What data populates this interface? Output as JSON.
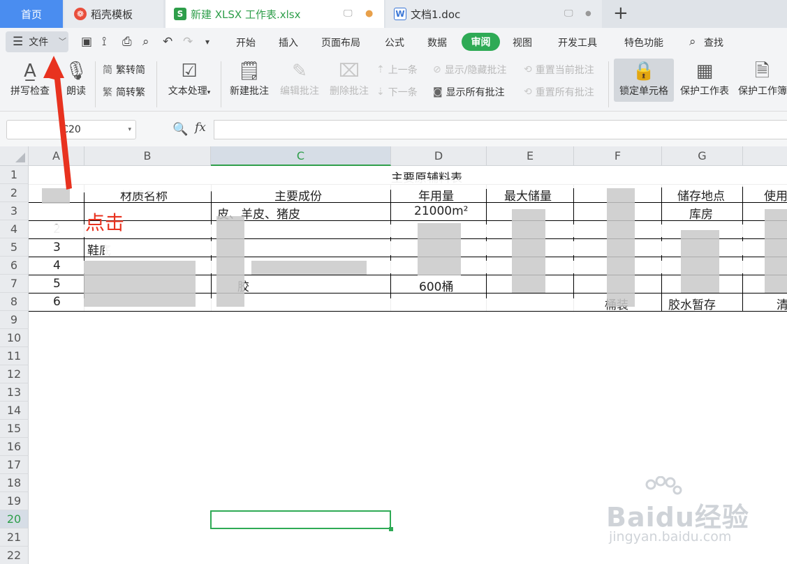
{
  "tabs": {
    "home": "首页",
    "template": "稻壳模板",
    "xlsx": "新建 XLSX 工作表.xlsx",
    "word": "文档1.doc",
    "add": "+"
  },
  "menu": {
    "file": "文件",
    "items": [
      "开始",
      "插入",
      "页面布局",
      "公式",
      "数据",
      "审阅",
      "视图",
      "开发工具",
      "特色功能",
      "查找"
    ],
    "active": "审阅"
  },
  "ribbon": {
    "spell_check": "拼写检查",
    "read_aloud": "朗读",
    "trad_to_simp": "繁转简",
    "simp_to_trad": "简转繁",
    "text_processing": "文本处理",
    "new_comment": "新建批注",
    "edit_comment": "编辑批注",
    "delete_comment": "删除批注",
    "prev": "上一条",
    "next": "下一条",
    "show_hide_comments": "显示/隐藏批注",
    "show_all_comments": "显示所有批注",
    "reset_current_comment": "重置当前批注",
    "reset_all_comments": "重置所有批注",
    "lock_cell": "锁定单元格",
    "protect_sheet": "保护工作表",
    "protect_workbook": "保护工作簿"
  },
  "formula_bar": {
    "name_box": "C20",
    "fx": "fx"
  },
  "grid": {
    "columns": [
      "A",
      "B",
      "C",
      "D",
      "E",
      "F",
      "G"
    ],
    "col_partial": "",
    "rows": [
      "1",
      "2",
      "3",
      "4",
      "5",
      "6",
      "7",
      "8",
      "9",
      "10",
      "11",
      "12",
      "13",
      "14",
      "15",
      "16",
      "17",
      "18",
      "19",
      "20",
      "21",
      "22"
    ],
    "active_column": "C",
    "active_row": "20",
    "title": "主要原辅料表",
    "headers": {
      "b": "材质名称",
      "c": "主要成份",
      "d": "年用量",
      "e": "最大储量",
      "g": "储存地点",
      "h": "使用"
    },
    "row3": {
      "c": "皮、羊皮、猪皮",
      "d": "21000m²",
      "g": "库房"
    },
    "row4": {
      "a": "2"
    },
    "row5": {
      "a": "3",
      "b": "鞋底"
    },
    "row6": {
      "a": "4"
    },
    "row7": {
      "a": "5",
      "c": "胶",
      "d": "600桶"
    },
    "row8": {
      "a": "6",
      "f": "桶装",
      "g": "胶水暂存",
      "h": "清"
    }
  },
  "annotation": {
    "text": "点击",
    "color": "#e8321f"
  },
  "watermark": {
    "main": "Baidu经验",
    "sub": "jingyan.baidu.com"
  },
  "colors": {
    "accent_green": "#2eaa55",
    "home_tab_blue": "#4a8df0"
  }
}
